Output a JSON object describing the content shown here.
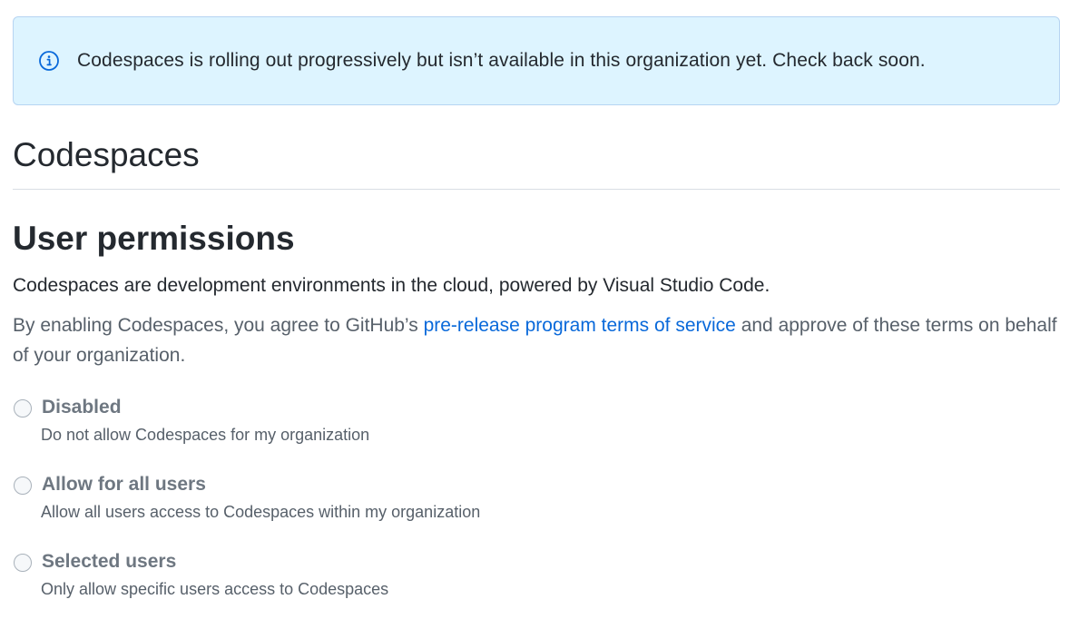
{
  "flash": {
    "icon": "info-icon",
    "message": "Codespaces is rolling out progressively but isn’t available in this organization yet. Check back soon.",
    "background_color": "#ddf4ff",
    "border_color": "#b6d4f2"
  },
  "page_title": "Codespaces",
  "section": {
    "heading": "User permissions",
    "description": "Codespaces are development environments in the cloud, powered by Visual Studio Code.",
    "terms_prefix": "By enabling Codespaces, you agree to GitHub’s ",
    "terms_link": "pre-release program terms of service",
    "terms_suffix": " and approve of these terms on behalf of your organization.",
    "link_color": "#0969da"
  },
  "options": [
    {
      "label": "Disabled",
      "help": "Do not allow Codespaces for my organization",
      "selected": false
    },
    {
      "label": "Allow for all users",
      "help": "Allow all users access to Codespaces within my organization",
      "selected": false
    },
    {
      "label": "Selected users",
      "help": "Only allow specific users access to Codespaces",
      "selected": false
    }
  ]
}
